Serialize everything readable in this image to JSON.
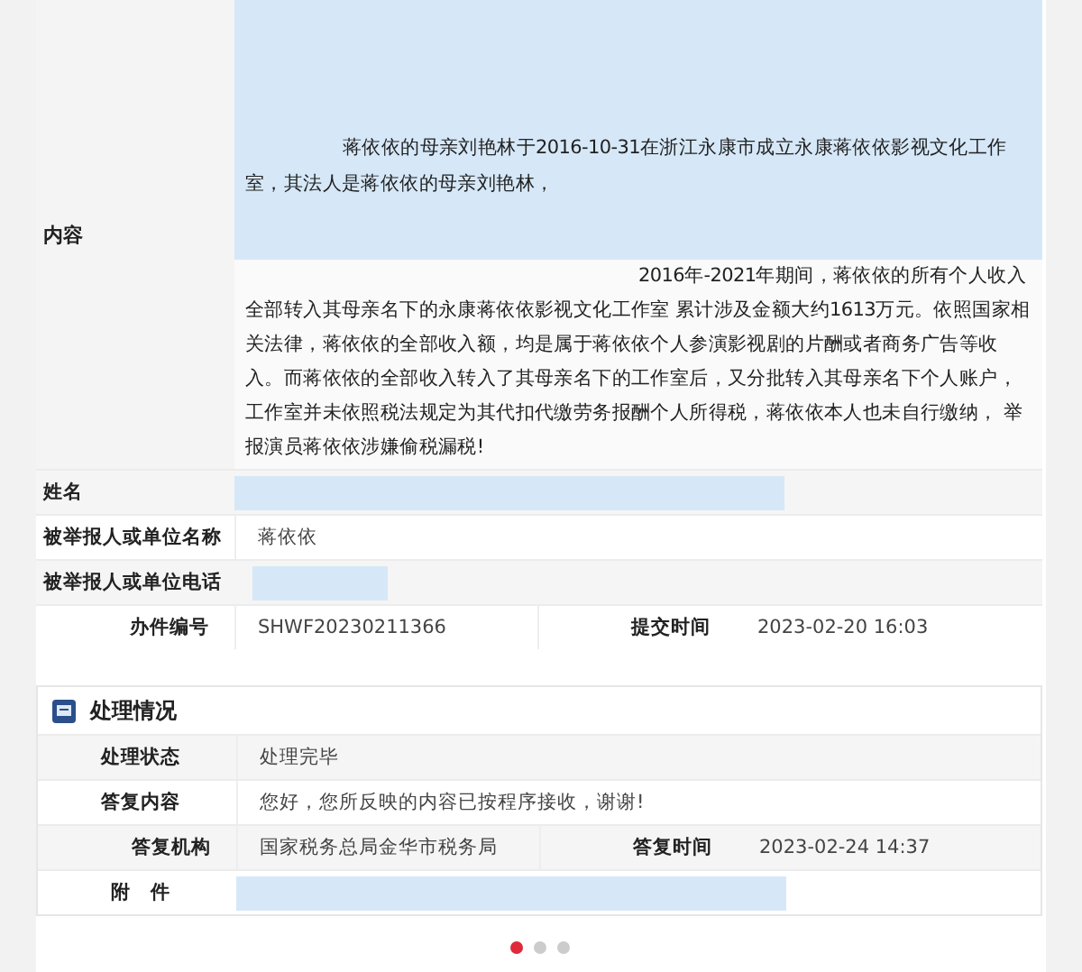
{
  "report": {
    "content_label": "内容",
    "paragraphs": [
      "蒋依依的母亲刘艳林于2016-10-31在浙江永康市成立永康蒋依依影视文化工作室，其法人是蒋依依的母亲刘艳林，",
      "2016年-2021年期间，蒋依依的所有个人收入全部转入其母亲名下的永康蒋依依影视文化工作室 累计涉及金额大约1613万元。依照国家相关法律，蒋依依的全部收入额，均是属于蒋依依个人参演影视剧的片酬或者商务广告等收入。而蒋依依的全部收入转入了其母亲名下的工作室后，又分批转入其母亲名下个人账户，工作室并未依照税法规定为其代扣代缴劳务报酬个人所得税，蒋依依本人也未自行缴纳，     举报演员蒋依依涉嫌偷税漏税!"
    ],
    "fields": [
      {
        "kind": "redacted_long",
        "label": "姓名"
      },
      {
        "kind": "text",
        "label": "被举报人或单位名称",
        "value": "蒋依依"
      },
      {
        "kind": "redacted_short",
        "label": "被举报人或单位电话"
      },
      {
        "kind": "pair",
        "label": "办件编号",
        "value": "SHWF20230211366",
        "label_2": "提交时间",
        "value_2": "2023-02-20 16:03"
      }
    ]
  },
  "processing": {
    "title": "处理情况",
    "fields": [
      {
        "kind": "text",
        "label": "处理状态",
        "value": "处理完毕"
      },
      {
        "kind": "text",
        "label": "答复内容",
        "value": "您好，您所反映的内容已按程序接收，谢谢!"
      },
      {
        "kind": "pair",
        "label": "答复机构",
        "value": "国家税务总局金华市税务局",
        "label_2": "答复时间",
        "value_2": "2023-02-24 14:37"
      },
      {
        "kind": "redacted_long",
        "label": "附　件"
      }
    ]
  },
  "pager": [
    {
      "selected": true
    },
    {
      "selected": false
    },
    {
      "selected": false
    }
  ]
}
